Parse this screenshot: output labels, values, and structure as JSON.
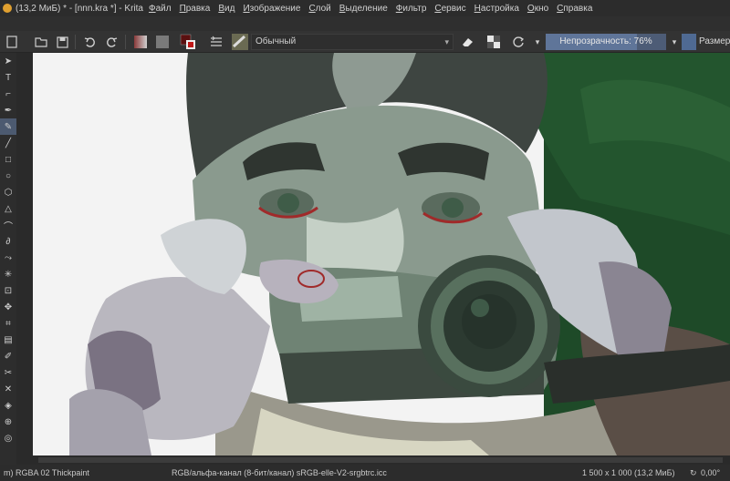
{
  "window": {
    "title": "(13,2 МиБ)  * - [nnn.kra *] - Krita"
  },
  "menu": {
    "items": [
      "Файл",
      "Правка",
      "Вид",
      "Изображение",
      "Слой",
      "Выделение",
      "Фильтр",
      "Сервис",
      "Настройка",
      "Окно",
      "Справка"
    ]
  },
  "toolbar": {
    "blend_mode": "Обычный",
    "opacity_label": "Непрозрачность: 76%",
    "opacity_value": 0.76,
    "size_label": "Размер"
  },
  "statusbar": {
    "brush": "m) RGBA 02 Thickpaint",
    "color_model": "RGB/альфа-канал (8-бит/канал)  sRGB-elle-V2-srgbtrc.icc",
    "image_size": "1 500 х 1 000 (13,2 МиБ)",
    "zoom": "0,00°"
  },
  "colors": {
    "accent": "#4c5a70",
    "background_green": "#1f4a2a",
    "skin_light": "#b8c4b8"
  }
}
